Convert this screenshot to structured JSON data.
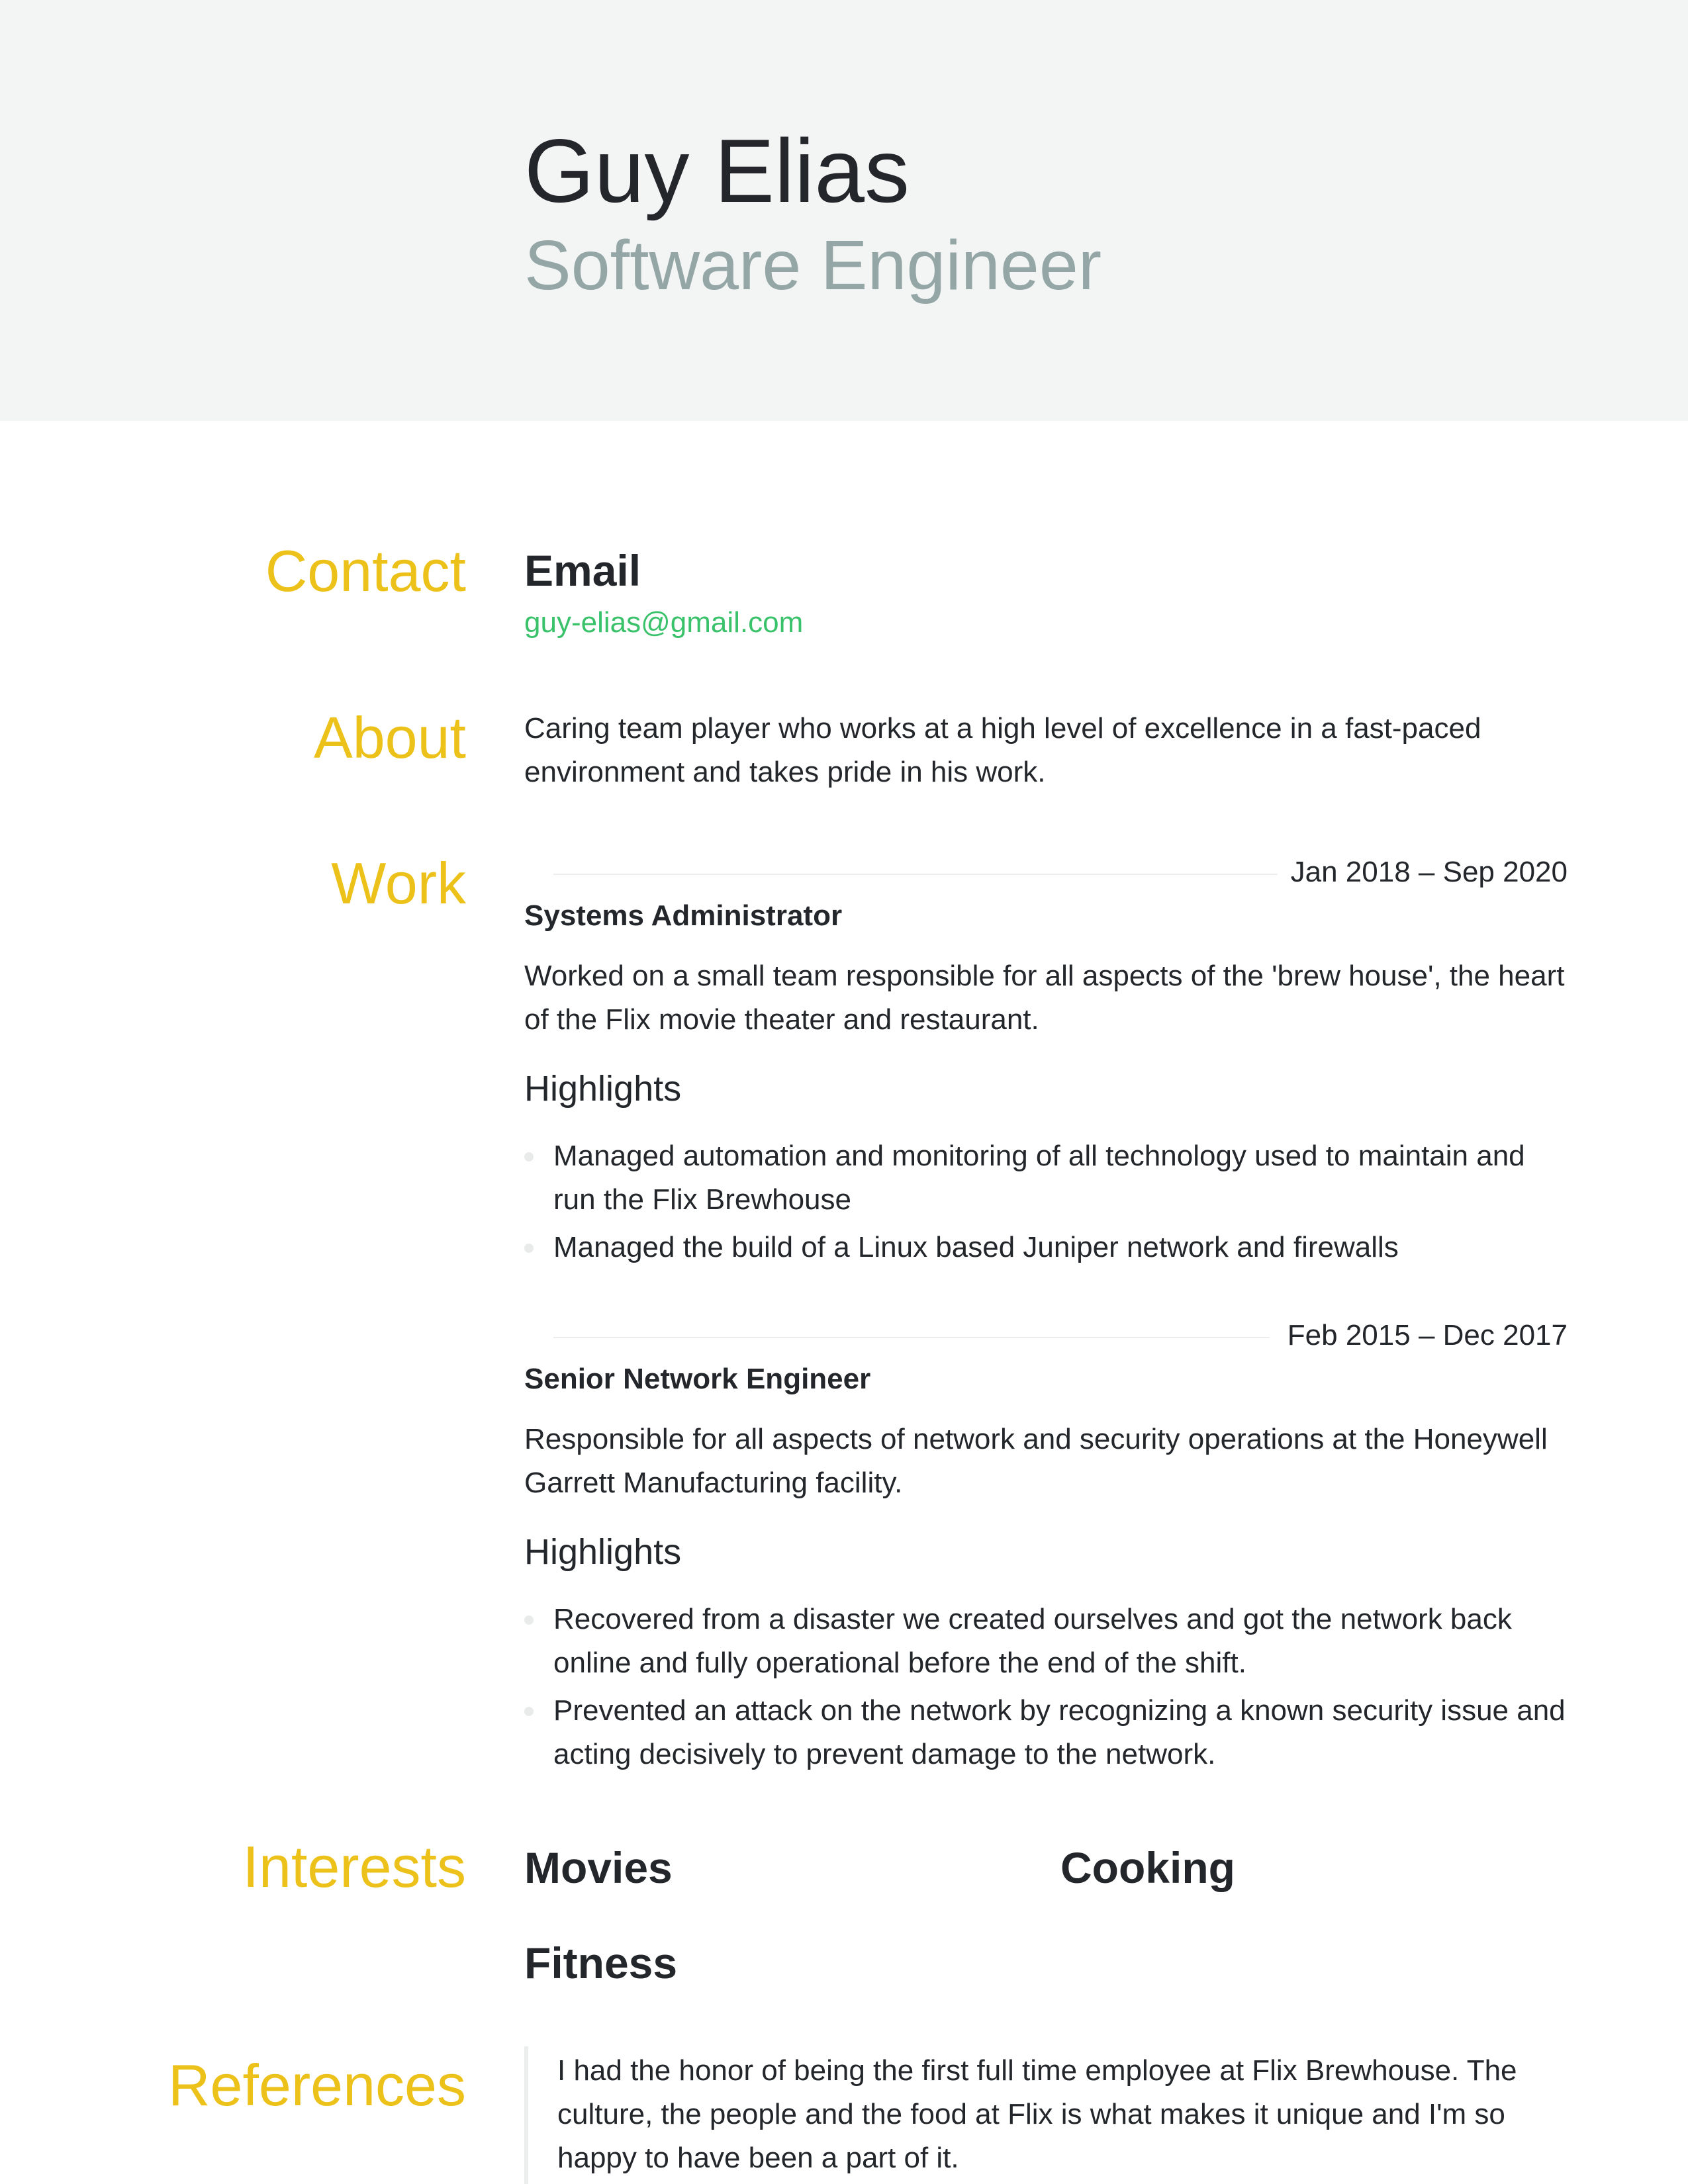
{
  "header": {
    "name": "Guy Elias",
    "title": "Software Engineer"
  },
  "sections": {
    "contact": "Contact",
    "about": "About",
    "work": "Work",
    "interests": "Interests",
    "references": "References"
  },
  "contact": {
    "email_label": "Email",
    "email": "guy-elias@gmail.com"
  },
  "about": {
    "text": "Caring team player who works at a high level of excellence in a fast-paced environment and takes pride in his work."
  },
  "work": [
    {
      "dates": "Jan 2018 – Sep 2020",
      "position": "Systems Administrator",
      "summary": "Worked on a small team responsible for all aspects of the 'brew house', the heart of the Flix movie theater and restaurant.",
      "highlights_title": "Highlights",
      "highlights": [
        "Managed automation and monitoring of all technology used to maintain and run the Flix Brewhouse",
        "Managed the build of a Linux based Juniper network and firewalls"
      ]
    },
    {
      "dates": "Feb 2015 – Dec 2017",
      "position": "Senior Network Engineer",
      "summary": "Responsible for all aspects of network and security operations at the Honeywell Garrett Manufacturing facility.",
      "highlights_title": "Highlights",
      "highlights": [
        "Recovered from a disaster we created ourselves and got the network back online and fully operational before the end of the shift.",
        "Prevented an attack on the network by recognizing a known security issue and acting decisively to prevent damage to the network."
      ]
    }
  ],
  "interests": [
    "Movies",
    "Cooking",
    "Fitness"
  ],
  "references": [
    {
      "text": "I had the honor of being the first full time employee at Flix Brewhouse. The culture, the people and the food at Flix is what makes it unique and I'm so happy to have been a part of it."
    }
  ],
  "colors": {
    "header_bg": "#f3f5f4",
    "section_label": "#ecc21a",
    "title": "#94a6a6",
    "email": "#3ac26b",
    "text": "#23272b"
  }
}
